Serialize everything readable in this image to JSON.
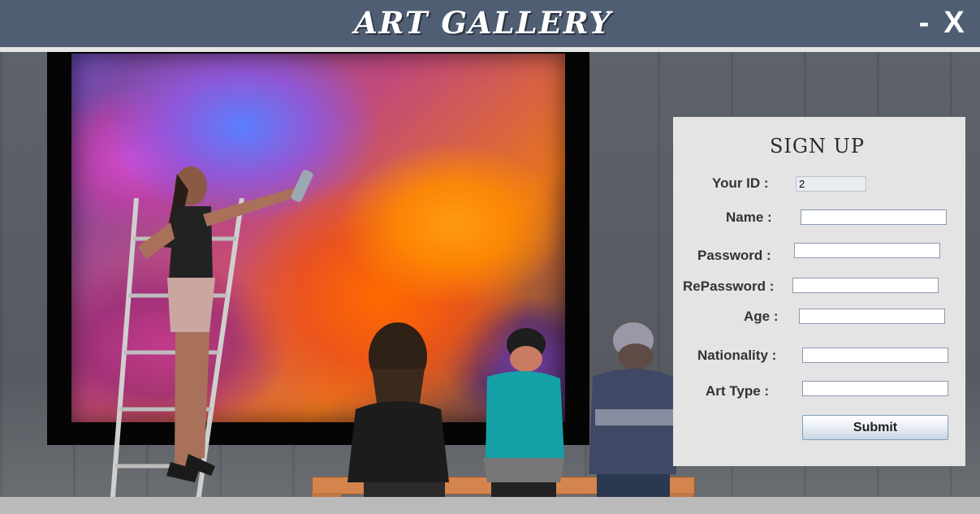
{
  "window": {
    "title": "ART GALLERY",
    "minimize_label": "-",
    "close_label": "X"
  },
  "signup": {
    "title": "SIGN UP",
    "fields": [
      {
        "label": "Your ID :",
        "value": "2"
      },
      {
        "label": "Name :",
        "value": ""
      },
      {
        "label": "Password :",
        "value": ""
      },
      {
        "label": "RePassword :",
        "value": ""
      },
      {
        "label": "Age :",
        "value": ""
      },
      {
        "label": "Nationality :",
        "value": ""
      },
      {
        "label": "Art Type :",
        "value": ""
      }
    ],
    "submit_label": "Submit"
  },
  "colors": {
    "titlebar": "#4f5e73",
    "panel": "#e4e4e4"
  }
}
